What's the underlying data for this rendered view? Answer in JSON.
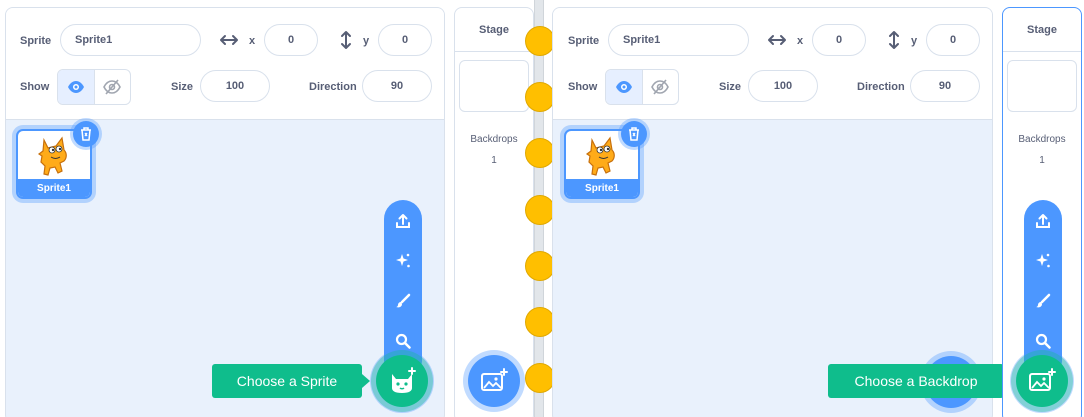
{
  "left": {
    "sprite_label": "Sprite",
    "sprite_name": "Sprite1",
    "x_label": "x",
    "x_value": "0",
    "y_label": "y",
    "y_value": "0",
    "show_label": "Show",
    "size_label": "Size",
    "size_value": "100",
    "direction_label": "Direction",
    "direction_value": "90",
    "sprites": [
      {
        "name": "Sprite1"
      }
    ],
    "stage": {
      "header": "Stage",
      "backdrops_label": "Backdrops",
      "backdrops_count": "1"
    },
    "tooltip": "Choose a Sprite"
  },
  "right": {
    "sprite_label": "Sprite",
    "sprite_name": "Sprite1",
    "x_label": "x",
    "x_value": "0",
    "y_label": "y",
    "y_value": "0",
    "show_label": "Show",
    "size_label": "Size",
    "size_value": "100",
    "direction_label": "Direction",
    "direction_value": "90",
    "sprites": [
      {
        "name": "Sprite1"
      }
    ],
    "stage": {
      "header": "Stage",
      "backdrops_label": "Backdrops",
      "backdrops_count": "1"
    },
    "tooltip": "Choose a Backdrop"
  },
  "colors": {
    "accent_blue": "#4c97ff",
    "accent_green": "#0fbd8c",
    "panel_bg": "#e9f1fc",
    "connector": "#ffbf00"
  },
  "icons": [
    "left-right-arrow-icon",
    "up-down-arrow-icon",
    "eye-icon",
    "eye-off-icon",
    "trash-icon",
    "upload-icon",
    "sparkle-icon",
    "paint-icon",
    "search-icon",
    "cat-icon",
    "backdrop-image-icon"
  ]
}
